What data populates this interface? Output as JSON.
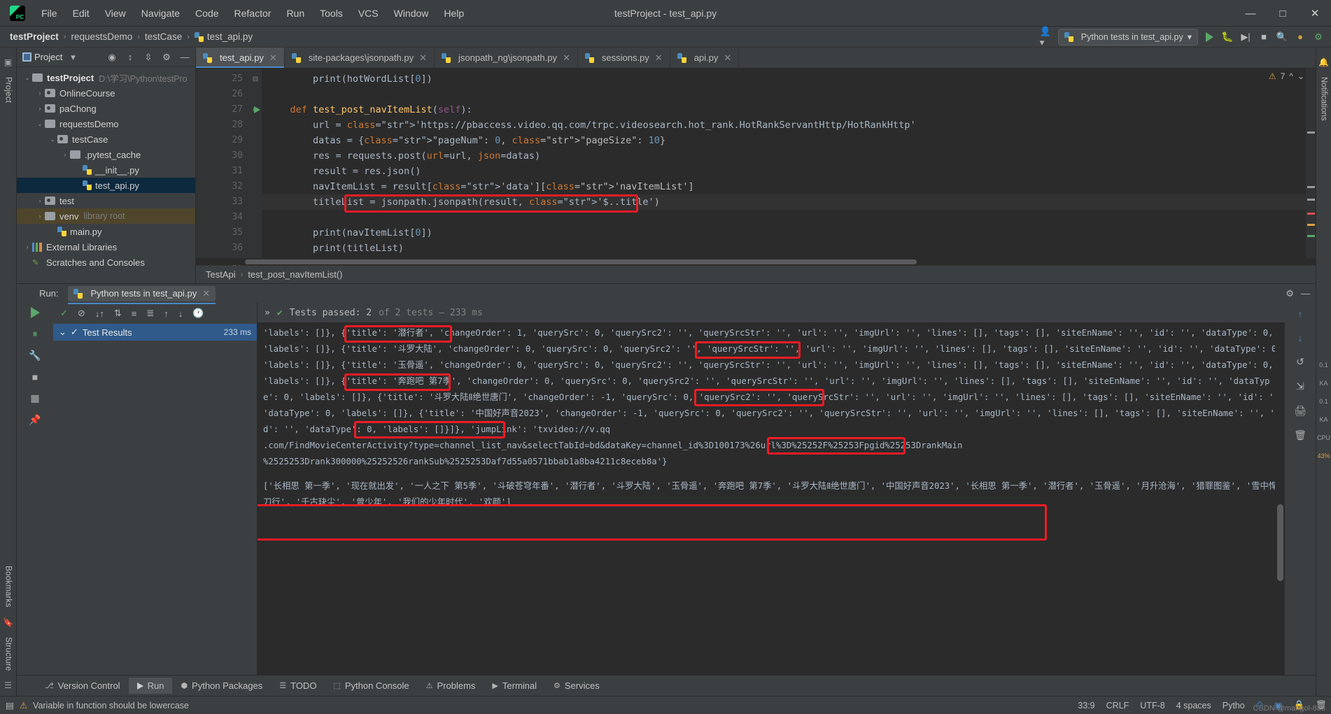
{
  "window": {
    "title": "testProject - test_api.py",
    "minimize": "—",
    "maximize": "□",
    "close": "✕"
  },
  "menubar": [
    "File",
    "Edit",
    "View",
    "Navigate",
    "Code",
    "Refactor",
    "Run",
    "Tools",
    "VCS",
    "Window",
    "Help"
  ],
  "breadcrumb": {
    "items": [
      "testProject",
      "requestsDemo",
      "testCase",
      "test_api.py"
    ],
    "separator": "›"
  },
  "navbar_right": {
    "run_config": "Python tests in test_api.py",
    "dropdown_caret": "▾"
  },
  "left_strip": {
    "label": "Project",
    "bookmarks": "Bookmarks",
    "structure": "Structure"
  },
  "right_strip": {
    "label": "Notifications"
  },
  "project_panel": {
    "title": "Project",
    "caret": "▾",
    "tree": [
      {
        "indent": 0,
        "arrow": "⌄",
        "icon": "folder",
        "label": "testProject",
        "bold": true,
        "sub": "D:\\学习\\Python\\testPro",
        "state": "normal"
      },
      {
        "indent": 1,
        "arrow": "›",
        "icon": "folder-src",
        "label": "OnlineCourse",
        "bold": false,
        "sub": "",
        "state": "normal"
      },
      {
        "indent": 1,
        "arrow": "›",
        "icon": "folder-src",
        "label": "paChong",
        "bold": false,
        "sub": "",
        "state": "normal"
      },
      {
        "indent": 1,
        "arrow": "⌄",
        "icon": "folder",
        "label": "requestsDemo",
        "bold": false,
        "sub": "",
        "state": "normal"
      },
      {
        "indent": 2,
        "arrow": "⌄",
        "icon": "folder-src",
        "label": "testCase",
        "bold": false,
        "sub": "",
        "state": "normal"
      },
      {
        "indent": 3,
        "arrow": "›",
        "icon": "folder",
        "label": ".pytest_cache",
        "bold": false,
        "sub": "",
        "state": "normal"
      },
      {
        "indent": 4,
        "arrow": "",
        "icon": "python",
        "label": "__init__.py",
        "bold": false,
        "sub": "",
        "state": "normal"
      },
      {
        "indent": 4,
        "arrow": "",
        "icon": "python",
        "label": "test_api.py",
        "bold": false,
        "sub": "",
        "state": "selected"
      },
      {
        "indent": 1,
        "arrow": "›",
        "icon": "folder-src",
        "label": "test",
        "bold": false,
        "sub": "",
        "state": "normal"
      },
      {
        "indent": 1,
        "arrow": "›",
        "icon": "folder",
        "label": "venv",
        "bold": false,
        "sub": "library root",
        "state": "highlight"
      },
      {
        "indent": 2,
        "arrow": "",
        "icon": "python",
        "label": "main.py",
        "bold": false,
        "sub": "",
        "state": "normal"
      },
      {
        "indent": 0,
        "arrow": "›",
        "icon": "library",
        "label": "External Libraries",
        "bold": false,
        "sub": "",
        "state": "normal"
      },
      {
        "indent": 0,
        "arrow": "",
        "icon": "scratch",
        "label": "Scratches and Consoles",
        "bold": false,
        "sub": "",
        "state": "normal"
      }
    ]
  },
  "editor": {
    "tabs": [
      {
        "label": "test_api.py",
        "active": true
      },
      {
        "label": "site-packages\\jsonpath.py",
        "active": false
      },
      {
        "label": "jsonpath_ng\\jsonpath.py",
        "active": false
      },
      {
        "label": "sessions.py",
        "active": false
      },
      {
        "label": "api.py",
        "active": false
      }
    ],
    "warning_count": "7",
    "warning_icon": "⚠",
    "lines": [
      {
        "no": "25",
        "text": "        print(hotWordList[0])",
        "partial": true
      },
      {
        "no": "26",
        "text": ""
      },
      {
        "no": "27",
        "text": "    def test_post_navItemList(self):",
        "runnable": true
      },
      {
        "no": "28",
        "text": "        url = 'https://pbaccess.video.qq.com/trpc.videosearch.hot_rank.HotRankServantHttp/HotRankHttp'"
      },
      {
        "no": "29",
        "text": "        datas = {\"pageNum\": 0, \"pageSize\": 10}"
      },
      {
        "no": "30",
        "text": "        res = requests.post(url=url, json=datas)"
      },
      {
        "no": "31",
        "text": "        result = res.json()"
      },
      {
        "no": "32",
        "text": "        navItemList = result['data']['navItemList']"
      },
      {
        "no": "33",
        "text": "        titleList = jsonpath.jsonpath(result, '$..title')",
        "current": true,
        "highlighted": true
      },
      {
        "no": "34",
        "text": ""
      },
      {
        "no": "35",
        "text": "        print(navItemList[0])"
      },
      {
        "no": "36",
        "text": "        print(titleList)"
      },
      {
        "no": "37",
        "text": ""
      }
    ],
    "breadcrumb_bottom": [
      "TestApi",
      "test_post_navItemList()"
    ]
  },
  "run_window": {
    "label": "Run:",
    "tab": "Python tests in test_api.py",
    "tab_close": "✕",
    "results_header": "Test Results",
    "results_time": "233 ms",
    "status_line": {
      "expand": "»",
      "check": "✔",
      "text": "Tests passed: 2",
      "muted": " of 2 tests – 233 ms"
    },
    "console_text": "'labels': []}, {'title': '潜行者', 'changeOrder': 1, 'querySrc': 0, 'querySrc2': '', 'querySrcStr': '', 'url': '', 'imgUrl': '', 'lines': [], 'tags': [], 'siteEnName': '', 'id': '', 'dataType': 0, 'labels': []}, {'title': '斗罗大陆', 'changeOrder': 0, 'querySrc': 0, 'querySrc2': '', 'querySrcStr': '', 'url': '', 'imgUrl': '', 'lines': [], 'tags': [], 'siteEnName': '', 'id': '', 'dataType': 0, 'labels': []}, {'title': '玉骨遥', 'changeOrder': 0, 'querySrc': 0, 'querySrc2': '', 'querySrcStr': '', 'url': '', 'imgUrl': '', 'lines': [], 'tags': [], 'siteEnName': '', 'id': '', 'dataType': 0, 'labels': []}, {'title': '奔跑吧 第7季', 'changeOrder': 0, 'querySrc': 0, 'querySrc2': '', 'querySrcStr': '', 'url': '', 'imgUrl': '', 'lines': [], 'tags': [], 'siteEnName': '', 'id': '', 'dataType': 0, 'labels': []}, {'title': '斗罗大陆Ⅱ绝世唐门', 'changeOrder': -1, 'querySrc': 0, 'querySrc2': '', 'querySrcStr': '', 'url': '', 'imgUrl': '', 'lines': [], 'tags': [], 'siteEnName': '', 'id': '', 'dataType': 0, 'labels': []}, {'title': '中国好声音2023', 'changeOrder': -1, 'querySrc': 0, 'querySrc2': '', 'querySrcStr': '', 'url': '', 'imgUrl': '', 'lines': [], 'tags': [], 'siteEnName': '', 'id': '', 'dataType': 0, 'labels': []}]}, 'jumpLink': 'txvideo://v.qq\n.com/FindMovieCenterActivity?type=channel_list_nav&selectTabId=bd&dataKey=channel_id%3D100173%26url%3D%25252F%25253Fpgid%25253DrankMain\n%2525253Drank300000%25252526rankSub%2525253Daf7d55a0571bbab1a8ba4211c8eceb8a'}",
    "console_list_line": "['长相思 第一季', '现在就出发', '一人之下 第5季', '斗破苍穹年番', '潜行者', '斗罗大陆', '玉骨遥', '奔跑吧 第7季', '斗罗大陆Ⅱ绝世唐门', '中国好声音2023', '长相思 第一季', '潜行者', '玉骨遥', '月升沧海', '猎罪图鉴', '雪中悍刀行', '千古玦尘', '曾少年', '我们的少年时代', '欢颜']",
    "highlight_color": "#ee1c25",
    "highlights": [
      {
        "label": "{'title': '潜行者',"
      },
      {
        "label": "'title': '斗罗大陆'"
      },
      {
        "label": "{'title': '玉骨遥',"
      },
      {
        "label": "'title': '奔跑吧 第7季'"
      },
      {
        "label": "'title': '斗罗大陆Ⅱ绝世唐门'"
      },
      {
        "label": "'title': '中国好声音2023'"
      }
    ]
  },
  "bottom_toolbar": [
    {
      "label": "Version Control",
      "icon": "branch-icon",
      "active": false
    },
    {
      "label": "Run",
      "icon": "run-icon",
      "active": true
    },
    {
      "label": "Python Packages",
      "icon": "python-icon",
      "active": false
    },
    {
      "label": "TODO",
      "icon": "todo-icon",
      "active": false
    },
    {
      "label": "Python Console",
      "icon": "console-icon",
      "active": false
    },
    {
      "label": "Problems",
      "icon": "problems-icon",
      "active": false
    },
    {
      "label": "Terminal",
      "icon": "terminal-icon",
      "active": false
    },
    {
      "label": "Services",
      "icon": "services-icon",
      "active": false
    }
  ],
  "statusbar": {
    "message": "Variable in function should be lowercase",
    "warn_icon": "⚠",
    "caret": "33:9",
    "line_sep": "CRLF",
    "encoding": "UTF-8",
    "indent": "4 spaces",
    "interpreter": "Pytho",
    "watermark": "CSDN @mangol-888"
  },
  "side_meters": [
    {
      "value": "0.1",
      "unit": "KA"
    },
    {
      "value": "0.1",
      "unit": "KA"
    },
    {
      "value": "CPU",
      "unit": ""
    },
    {
      "value": "43%",
      "unit": ""
    }
  ]
}
